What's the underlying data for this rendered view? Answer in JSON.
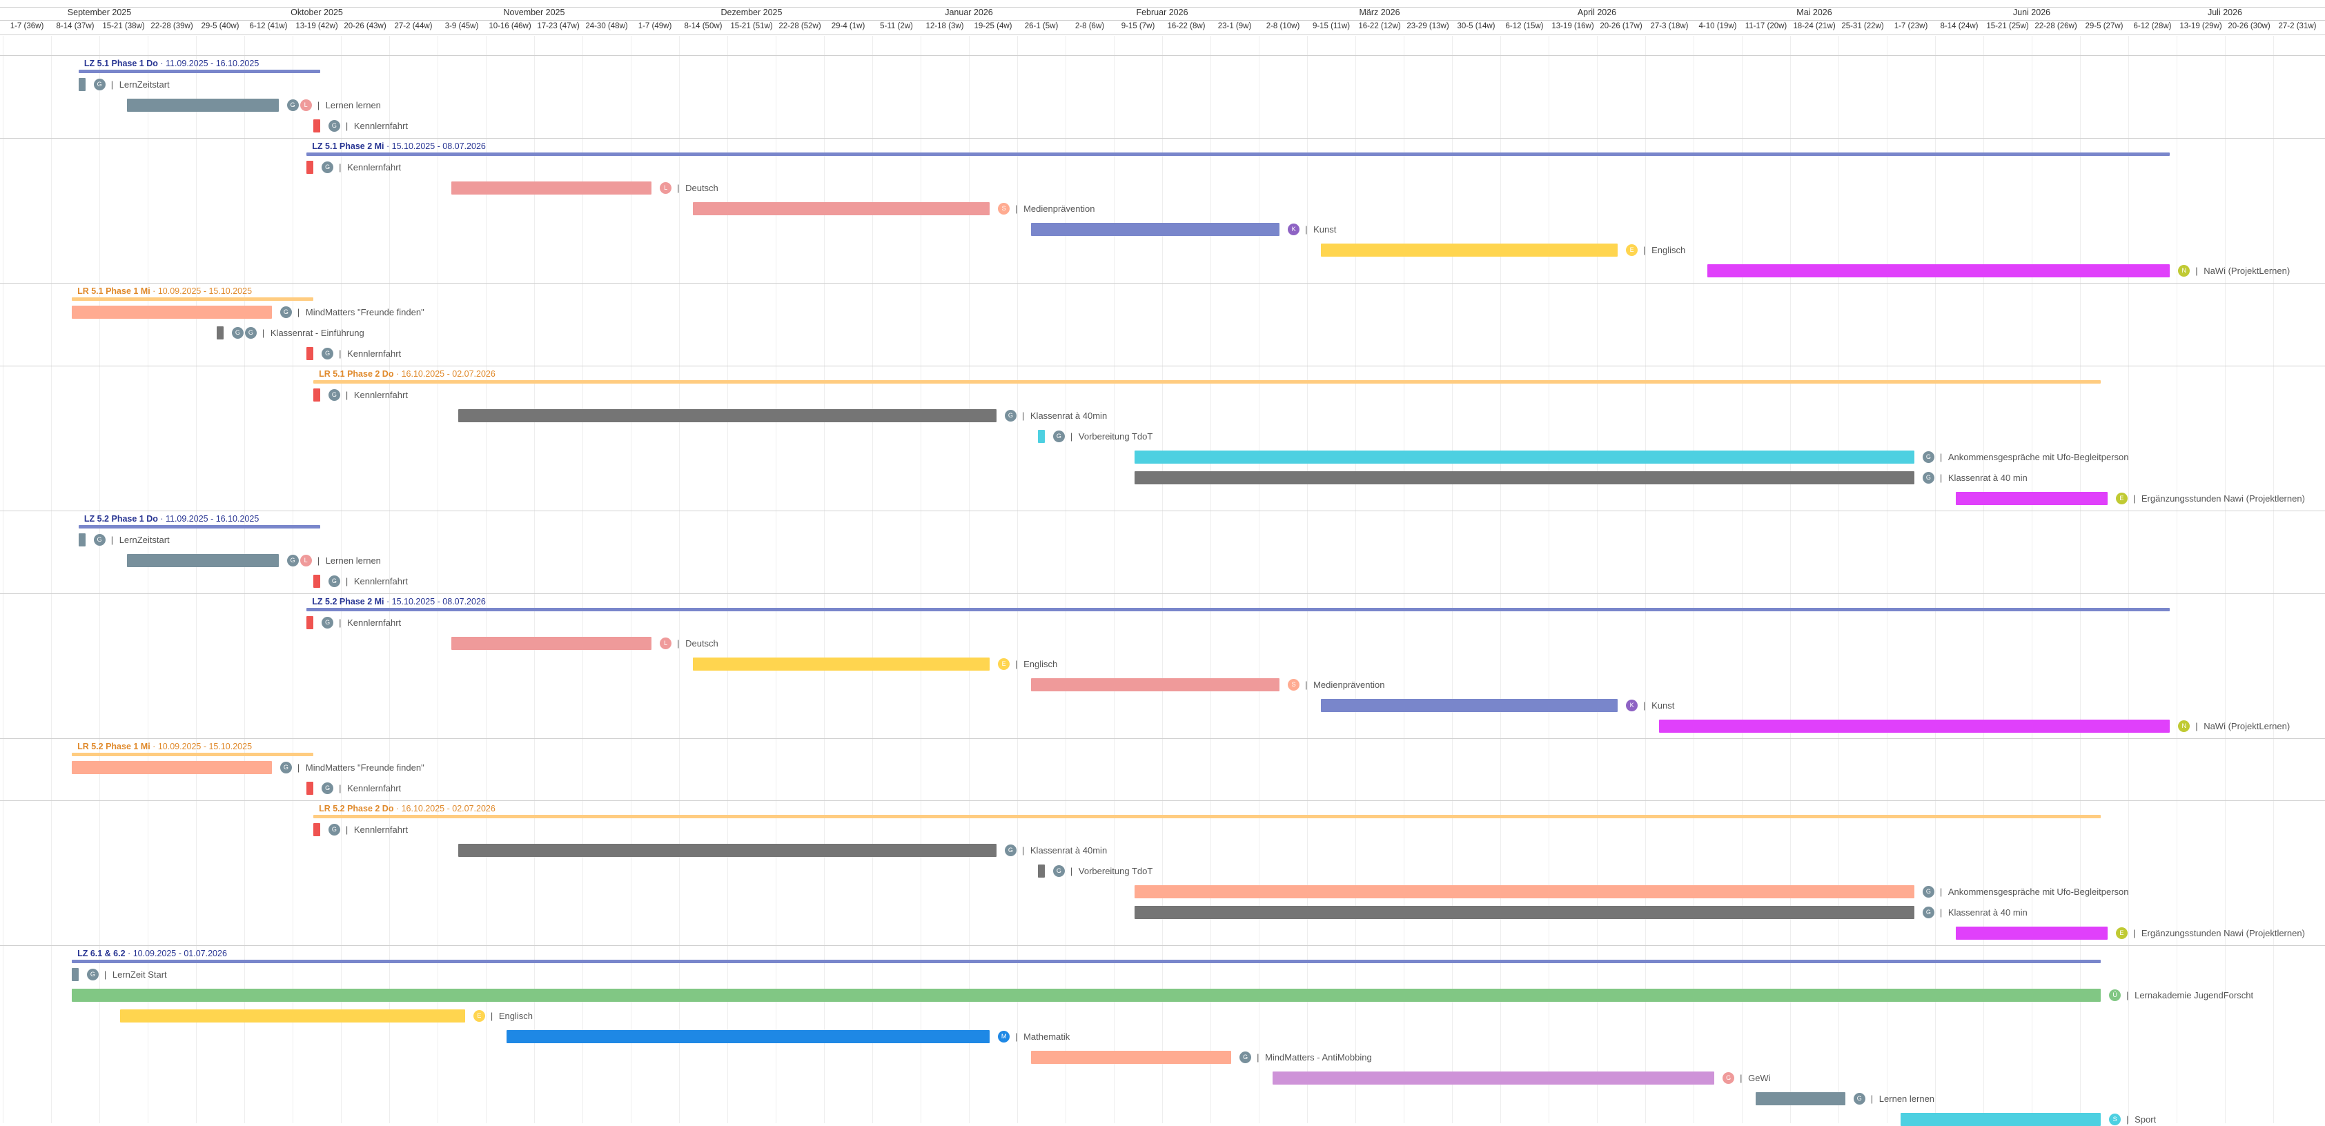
{
  "months": [
    {
      "label": "September 2025",
      "start": 0,
      "end": 4
    },
    {
      "label": "Oktober 2025",
      "start": 4,
      "end": 9
    },
    {
      "label": "November 2025",
      "start": 9,
      "end": 13
    },
    {
      "label": "Dezember 2025",
      "start": 13,
      "end": 18
    },
    {
      "label": "Januar 2026",
      "start": 18,
      "end": 22
    },
    {
      "label": "Februar 2026",
      "start": 22,
      "end": 26
    },
    {
      "label": "März 2026",
      "start": 26,
      "end": 31
    },
    {
      "label": "April 2026",
      "start": 31,
      "end": 35
    },
    {
      "label": "Mai 2026",
      "start": 35,
      "end": 40
    },
    {
      "label": "Juni 2026",
      "start": 40,
      "end": 44
    },
    {
      "label": "Juli 2026",
      "start": 44,
      "end": 48
    }
  ],
  "weeks": [
    "1-7 (36w)",
    "8-14 (37w)",
    "15-21 (38w)",
    "22-28 (39w)",
    "29-5 (40w)",
    "6-12 (41w)",
    "13-19 (42w)",
    "20-26 (43w)",
    "27-2 (44w)",
    "3-9 (45w)",
    "10-16 (46w)",
    "17-23 (47w)",
    "24-30 (48w)",
    "1-7 (49w)",
    "8-14 (50w)",
    "15-21 (51w)",
    "22-28 (52w)",
    "29-4 (1w)",
    "5-11 (2w)",
    "12-18 (3w)",
    "19-25 (4w)",
    "26-1 (5w)",
    "2-8 (6w)",
    "9-15 (7w)",
    "16-22 (8w)",
    "23-1 (9w)",
    "2-8 (10w)",
    "9-15 (11w)",
    "16-22 (12w)",
    "23-29 (13w)",
    "30-5 (14w)",
    "6-12 (15w)",
    "13-19 (16w)",
    "20-26 (17w)",
    "27-3 (18w)",
    "4-10 (19w)",
    "11-17 (20w)",
    "18-24 (21w)",
    "25-31 (22w)",
    "1-7 (23w)",
    "8-14 (24w)",
    "15-21 (25w)",
    "22-28 (26w)",
    "29-5 (27w)",
    "6-12 (28w)",
    "13-19 (29w)",
    "20-26 (30w)",
    "27-2 (31w)"
  ],
  "colors": {
    "lz_line": "#7986cb",
    "lz_title": "#283593",
    "lr_line": "#ffcc80",
    "lr_title": "#e08a2c",
    "grey": "#78909c",
    "red": "#ef5350",
    "pink": "#ef9a9a",
    "indigo": "#7986cb",
    "yellow": "#ffd54f",
    "magenta": "#e040fb",
    "salmon": "#ffab91",
    "dark": "#757575",
    "cyan": "#4dd0e1",
    "green": "#81c784",
    "blue": "#1e88e5",
    "lilac": "#ce93d8"
  },
  "groups": [
    {
      "title": "LZ 5.1 Phase 1 Do",
      "dates": "11.09.2025 - 16.10.2025",
      "kind": "lz",
      "start": 1.57,
      "end": 6.57,
      "tasks": [
        {
          "label": "LernZeitstart",
          "start": 1.57,
          "end": 1.71,
          "color": "grey",
          "avatars": [
            {
              "initials": "G",
              "color": "#78909c"
            }
          ]
        },
        {
          "label": "Lernen lernen",
          "start": 2.57,
          "end": 5.71,
          "color": "grey",
          "avatars": [
            {
              "initials": "G",
              "color": "#78909c"
            },
            {
              "initials": "L",
              "color": "#ef9a9a"
            }
          ]
        },
        {
          "label": "Kennlernfahrt",
          "start": 6.43,
          "end": 6.57,
          "color": "red",
          "avatars": [
            {
              "initials": "G",
              "color": "#78909c"
            }
          ]
        }
      ]
    },
    {
      "title": "LZ 5.1 Phase 2 Mi",
      "dates": "15.10.2025 - 08.07.2026",
      "kind": "lz",
      "start": 6.29,
      "end": 44.86,
      "tasks": [
        {
          "label": "Kennlernfahrt",
          "start": 6.29,
          "end": 6.43,
          "color": "red",
          "avatars": [
            {
              "initials": "G",
              "color": "#78909c"
            }
          ]
        },
        {
          "label": "Deutsch",
          "start": 9.29,
          "end": 13.43,
          "color": "pink",
          "avatars": [
            {
              "initials": "L",
              "color": "#ef9a9a"
            }
          ]
        },
        {
          "label": "Medienprävention",
          "start": 14.29,
          "end": 20.43,
          "color": "pink",
          "avatars": [
            {
              "initials": "S",
              "color": "#ffab91"
            }
          ]
        },
        {
          "label": "Kunst",
          "start": 21.29,
          "end": 26.43,
          "color": "indigo",
          "avatars": [
            {
              "initials": "K",
              "color": "#8e63c4"
            }
          ]
        },
        {
          "label": "Englisch",
          "start": 27.29,
          "end": 33.43,
          "color": "yellow",
          "avatars": [
            {
              "initials": "E",
              "color": "#ffd54f"
            }
          ]
        },
        {
          "label": "NaWi (ProjektLernen)",
          "start": 35.29,
          "end": 44.86,
          "color": "magenta",
          "avatars": [
            {
              "initials": "N",
              "color": "#c0ca33"
            }
          ]
        }
      ]
    },
    {
      "title": "LR 5.1 Phase 1 Mi",
      "dates": "10.09.2025 - 15.10.2025",
      "kind": "lr",
      "start": 1.43,
      "end": 6.43,
      "tasks": [
        {
          "label": "MindMatters \"Freunde finden\"",
          "start": 1.43,
          "end": 5.57,
          "color": "salmon",
          "avatars": [
            {
              "initials": "G",
              "color": "#78909c"
            }
          ]
        },
        {
          "label": "Klassenrat - Einführung",
          "start": 4.43,
          "end": 4.57,
          "color": "dark",
          "avatars": [
            {
              "initials": "G",
              "color": "#78909c"
            },
            {
              "initials": "G",
              "color": "#78909c"
            }
          ]
        },
        {
          "label": "Kennlernfahrt",
          "start": 6.29,
          "end": 6.43,
          "color": "red",
          "avatars": [
            {
              "initials": "G",
              "color": "#78909c"
            }
          ]
        }
      ]
    },
    {
      "title": "LR 5.1 Phase 2 Do",
      "dates": "16.10.2025 - 02.07.2026",
      "kind": "lr",
      "start": 6.43,
      "end": 43.43,
      "tasks": [
        {
          "label": "Kennlernfahrt",
          "start": 6.43,
          "end": 6.57,
          "color": "red",
          "avatars": [
            {
              "initials": "G",
              "color": "#78909c"
            }
          ]
        },
        {
          "label": "Klassenrat à 40min",
          "start": 9.43,
          "end": 20.57,
          "color": "dark",
          "avatars": [
            {
              "initials": "G",
              "color": "#78909c"
            }
          ]
        },
        {
          "label": "Vorbereitung TdoT",
          "start": 21.43,
          "end": 21.57,
          "color": "cyan",
          "avatars": [
            {
              "initials": "G",
              "color": "#78909c"
            }
          ]
        },
        {
          "label": "Ankommensgespräche mit Ufo-Begleitperson",
          "start": 23.43,
          "end": 39.57,
          "color": "cyan",
          "avatars": [
            {
              "initials": "G",
              "color": "#78909c"
            }
          ]
        },
        {
          "label": "Klassenrat à 40 min",
          "start": 23.43,
          "end": 39.57,
          "color": "dark",
          "avatars": [
            {
              "initials": "G",
              "color": "#78909c"
            }
          ]
        },
        {
          "label": "Ergänzungsstunden Nawi (Projektlernen)",
          "start": 40.43,
          "end": 43.57,
          "color": "magenta",
          "avatars": [
            {
              "initials": "E",
              "color": "#c0ca33"
            }
          ]
        }
      ]
    },
    {
      "title": "LZ 5.2 Phase 1 Do",
      "dates": "11.09.2025 - 16.10.2025",
      "kind": "lz",
      "start": 1.57,
      "end": 6.57,
      "tasks": [
        {
          "label": "LernZeitstart",
          "start": 1.57,
          "end": 1.71,
          "color": "grey",
          "avatars": [
            {
              "initials": "G",
              "color": "#78909c"
            }
          ]
        },
        {
          "label": "Lernen lernen",
          "start": 2.57,
          "end": 5.71,
          "color": "grey",
          "avatars": [
            {
              "initials": "G",
              "color": "#78909c"
            },
            {
              "initials": "L",
              "color": "#ef9a9a"
            }
          ]
        },
        {
          "label": "Kennlernfahrt",
          "start": 6.43,
          "end": 6.57,
          "color": "red",
          "avatars": [
            {
              "initials": "G",
              "color": "#78909c"
            }
          ]
        }
      ]
    },
    {
      "title": "LZ 5.2 Phase 2 Mi",
      "dates": "15.10.2025 - 08.07.2026",
      "kind": "lz",
      "start": 6.29,
      "end": 44.86,
      "tasks": [
        {
          "label": "Kennlernfahrt",
          "start": 6.29,
          "end": 6.43,
          "color": "red",
          "avatars": [
            {
              "initials": "G",
              "color": "#78909c"
            }
          ]
        },
        {
          "label": "Deutsch",
          "start": 9.29,
          "end": 13.43,
          "color": "pink",
          "avatars": [
            {
              "initials": "L",
              "color": "#ef9a9a"
            }
          ]
        },
        {
          "label": "Englisch",
          "start": 14.29,
          "end": 20.43,
          "color": "yellow",
          "avatars": [
            {
              "initials": "E",
              "color": "#ffd54f"
            }
          ]
        },
        {
          "label": "Medienprävention",
          "start": 21.29,
          "end": 26.43,
          "color": "pink",
          "avatars": [
            {
              "initials": "S",
              "color": "#ffab91"
            }
          ]
        },
        {
          "label": "Kunst",
          "start": 27.29,
          "end": 33.43,
          "color": "indigo",
          "avatars": [
            {
              "initials": "K",
              "color": "#8e63c4"
            }
          ]
        },
        {
          "label": "NaWi (ProjektLernen)",
          "start": 34.29,
          "end": 44.86,
          "color": "magenta",
          "avatars": [
            {
              "initials": "N",
              "color": "#c0ca33"
            }
          ]
        }
      ]
    },
    {
      "title": "LR 5.2 Phase 1 Mi",
      "dates": "10.09.2025 - 15.10.2025",
      "kind": "lr",
      "start": 1.43,
      "end": 6.43,
      "tasks": [
        {
          "label": "MindMatters \"Freunde finden\"",
          "start": 1.43,
          "end": 5.57,
          "color": "salmon",
          "avatars": [
            {
              "initials": "G",
              "color": "#78909c"
            }
          ]
        },
        {
          "label": "Kennlernfahrt",
          "start": 6.29,
          "end": 6.43,
          "color": "red",
          "avatars": [
            {
              "initials": "G",
              "color": "#78909c"
            }
          ]
        }
      ]
    },
    {
      "title": "LR 5.2 Phase 2 Do",
      "dates": "16.10.2025 - 02.07.2026",
      "kind": "lr",
      "start": 6.43,
      "end": 43.43,
      "tasks": [
        {
          "label": "Kennlernfahrt",
          "start": 6.43,
          "end": 6.57,
          "color": "red",
          "avatars": [
            {
              "initials": "G",
              "color": "#78909c"
            }
          ]
        },
        {
          "label": "Klassenrat à 40min",
          "start": 9.43,
          "end": 20.57,
          "color": "dark",
          "avatars": [
            {
              "initials": "G",
              "color": "#78909c"
            }
          ]
        },
        {
          "label": "Vorbereitung TdoT",
          "start": 21.43,
          "end": 21.57,
          "color": "dark",
          "avatars": [
            {
              "initials": "G",
              "color": "#78909c"
            }
          ]
        },
        {
          "label": "Ankommensgespräche mit Ufo-Begleitperson",
          "start": 23.43,
          "end": 39.57,
          "color": "salmon",
          "avatars": [
            {
              "initials": "G",
              "color": "#78909c"
            }
          ]
        },
        {
          "label": "Klassenrat à 40 min",
          "start": 23.43,
          "end": 39.57,
          "color": "dark",
          "avatars": [
            {
              "initials": "G",
              "color": "#78909c"
            }
          ]
        },
        {
          "label": "Ergänzungsstunden Nawi (Projektlernen)",
          "start": 40.43,
          "end": 43.57,
          "color": "magenta",
          "avatars": [
            {
              "initials": "E",
              "color": "#c0ca33"
            }
          ]
        }
      ]
    },
    {
      "title": "LZ 6.1 & 6.2",
      "dates": "10.09.2025 - 01.07.2026",
      "kind": "lz",
      "start": 1.43,
      "end": 43.43,
      "tasks": [
        {
          "label": "LernZeit Start",
          "start": 1.43,
          "end": 1.57,
          "color": "grey",
          "avatars": [
            {
              "initials": "G",
              "color": "#78909c"
            }
          ]
        },
        {
          "label": "Lernakademie JugendForscht",
          "start": 1.43,
          "end": 43.43,
          "color": "green",
          "avatars": [
            {
              "initials": "Ü",
              "color": "#81c784"
            }
          ]
        },
        {
          "label": "Englisch",
          "start": 2.43,
          "end": 9.57,
          "color": "yellow",
          "avatars": [
            {
              "initials": "E",
              "color": "#ffd54f"
            }
          ]
        },
        {
          "label": "Mathematik",
          "start": 10.43,
          "end": 20.43,
          "color": "blue",
          "avatars": [
            {
              "initials": "M",
              "color": "#1e88e5"
            }
          ]
        },
        {
          "label": "MindMatters - AntiMobbing",
          "start": 21.29,
          "end": 25.43,
          "color": "salmon",
          "avatars": [
            {
              "initials": "G",
              "color": "#78909c"
            }
          ]
        },
        {
          "label": "GeWi",
          "start": 26.29,
          "end": 35.43,
          "color": "lilac",
          "avatars": [
            {
              "initials": "G",
              "color": "#ef9a9a"
            }
          ]
        },
        {
          "label": "Lernen lernen",
          "start": 36.29,
          "end": 38.14,
          "color": "grey",
          "avatars": [
            {
              "initials": "G",
              "color": "#78909c"
            }
          ]
        },
        {
          "label": "Sport",
          "start": 39.29,
          "end": 43.43,
          "color": "cyan",
          "avatars": [
            {
              "initials": "S",
              "color": "#4dd0e1"
            }
          ]
        }
      ]
    }
  ]
}
